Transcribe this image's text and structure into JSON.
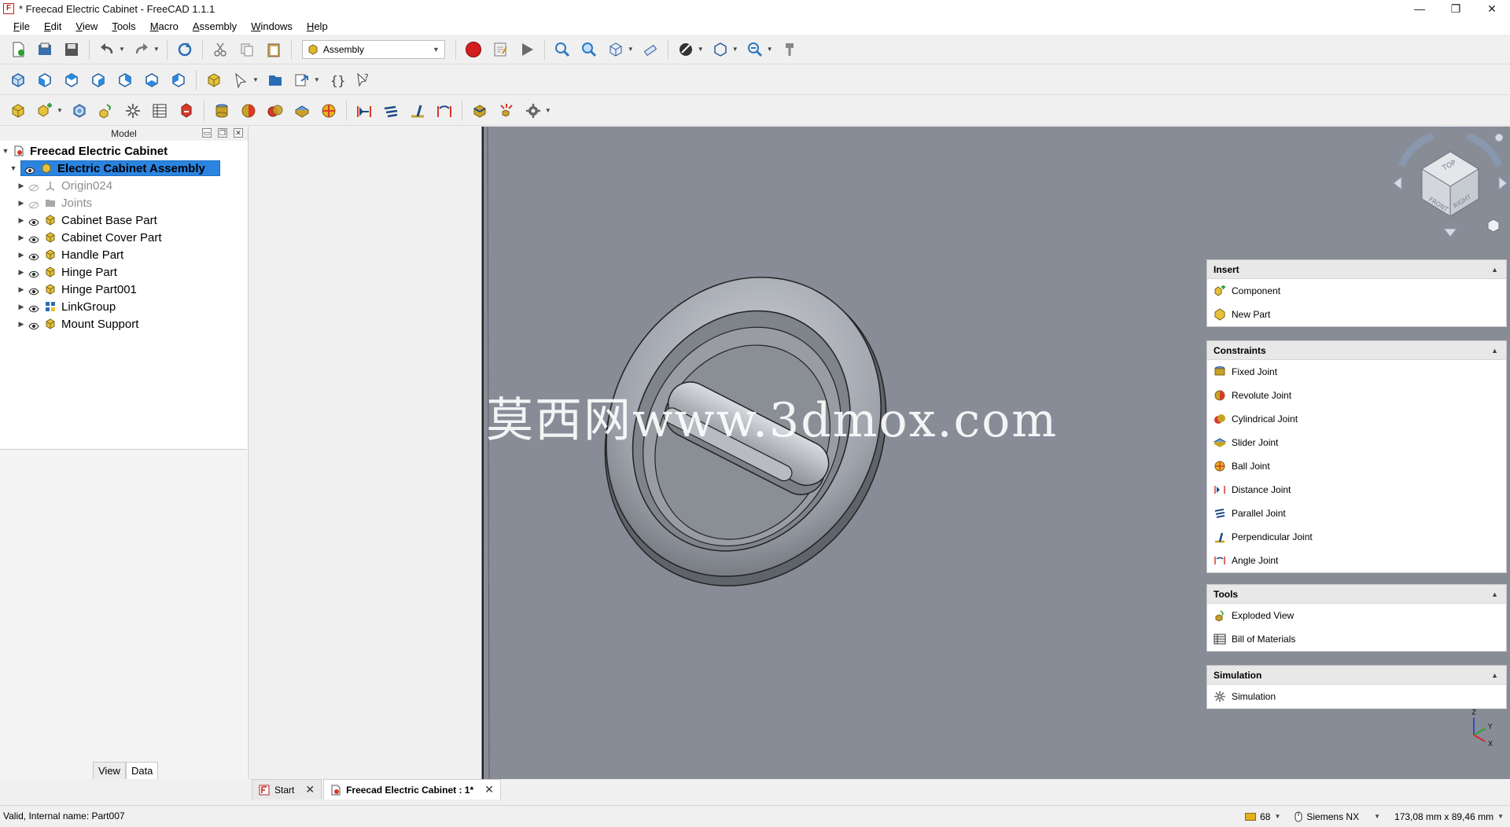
{
  "window": {
    "title": "* Freecad Electric Cabinet - FreeCAD 1.1.1",
    "app_icon_glyph": "F",
    "controls": {
      "minimize": "—",
      "maximize": "❐",
      "close": "✕"
    }
  },
  "menu": [
    "File",
    "Edit",
    "View",
    "Tools",
    "Macro",
    "Assembly",
    "Windows",
    "Help"
  ],
  "toolbar": {
    "workbench": "Assembly"
  },
  "model_panel": {
    "title": "Model",
    "tree": [
      {
        "label": "Freecad Electric Cabinet",
        "level": 0,
        "expander": "▼",
        "icon": "document-icon",
        "bold": true
      },
      {
        "label": "Electric Cabinet Assembly",
        "level": 1,
        "expander": "▼",
        "icon": "assembly-icon",
        "selected": true
      },
      {
        "label": "Origin024",
        "level": 2,
        "expander": "▶",
        "icon": "origin-icon",
        "dim": true
      },
      {
        "label": "Joints",
        "level": 2,
        "expander": "▶",
        "icon": "folder-icon",
        "dim": true
      },
      {
        "label": "Cabinet Base Part",
        "level": 2,
        "expander": "▶",
        "icon": "part-icon"
      },
      {
        "label": "Cabinet Cover Part",
        "level": 2,
        "expander": "▶",
        "icon": "part-icon"
      },
      {
        "label": "Handle Part",
        "level": 2,
        "expander": "▶",
        "icon": "part-icon"
      },
      {
        "label": "Hinge Part",
        "level": 2,
        "expander": "▶",
        "icon": "part-icon"
      },
      {
        "label": "Hinge Part001",
        "level": 2,
        "expander": "▶",
        "icon": "part-icon"
      },
      {
        "label": "LinkGroup",
        "level": 2,
        "expander": "▶",
        "icon": "linkgroup-icon"
      },
      {
        "label": "Mount Support",
        "level": 2,
        "expander": "▶",
        "icon": "part-icon"
      }
    ],
    "prop_tabs": [
      "View",
      "Data"
    ]
  },
  "viewport": {
    "watermark": "莫西网www.3dmox.com",
    "navcube_faces": {
      "top": "TOP",
      "front": "FRONT",
      "right": "RIGHT"
    },
    "axes": {
      "x": "X",
      "y": "Y",
      "z": "Z"
    }
  },
  "tasks": [
    {
      "title": "Insert",
      "items": [
        {
          "label": "Component",
          "icon": "component-icon"
        },
        {
          "label": "New Part",
          "icon": "new-part-icon"
        }
      ]
    },
    {
      "title": "Constraints",
      "items": [
        {
          "label": "Fixed Joint",
          "icon": "fixed-joint-icon"
        },
        {
          "label": "Revolute Joint",
          "icon": "revolute-joint-icon"
        },
        {
          "label": "Cylindrical Joint",
          "icon": "cylindrical-joint-icon"
        },
        {
          "label": "Slider Joint",
          "icon": "slider-joint-icon"
        },
        {
          "label": "Ball Joint",
          "icon": "ball-joint-icon"
        },
        {
          "label": "Distance Joint",
          "icon": "distance-joint-icon"
        },
        {
          "label": "Parallel Joint",
          "icon": "parallel-joint-icon"
        },
        {
          "label": "Perpendicular Joint",
          "icon": "perpendicular-joint-icon"
        },
        {
          "label": "Angle Joint",
          "icon": "angle-joint-icon"
        }
      ]
    },
    {
      "title": "Tools",
      "items": [
        {
          "label": "Exploded View",
          "icon": "exploded-view-icon"
        },
        {
          "label": "Bill of Materials",
          "icon": "bom-icon"
        }
      ]
    },
    {
      "title": "Simulation",
      "items": [
        {
          "label": "Simulation",
          "icon": "simulation-icon"
        }
      ]
    }
  ],
  "doc_tabs": [
    {
      "label": "Start",
      "active": false
    },
    {
      "label": "Freecad Electric Cabinet : 1*",
      "active": true
    }
  ],
  "status": {
    "message": "Valid, Internal name: Part007",
    "zoom_value": "68",
    "navigation_style": "Siemens NX",
    "dimensions": "173,08 mm x 89,46 mm"
  },
  "colors": {
    "selection": "#2a84e0",
    "viewport_bg": "#888c96",
    "record": "#d21e1e"
  }
}
